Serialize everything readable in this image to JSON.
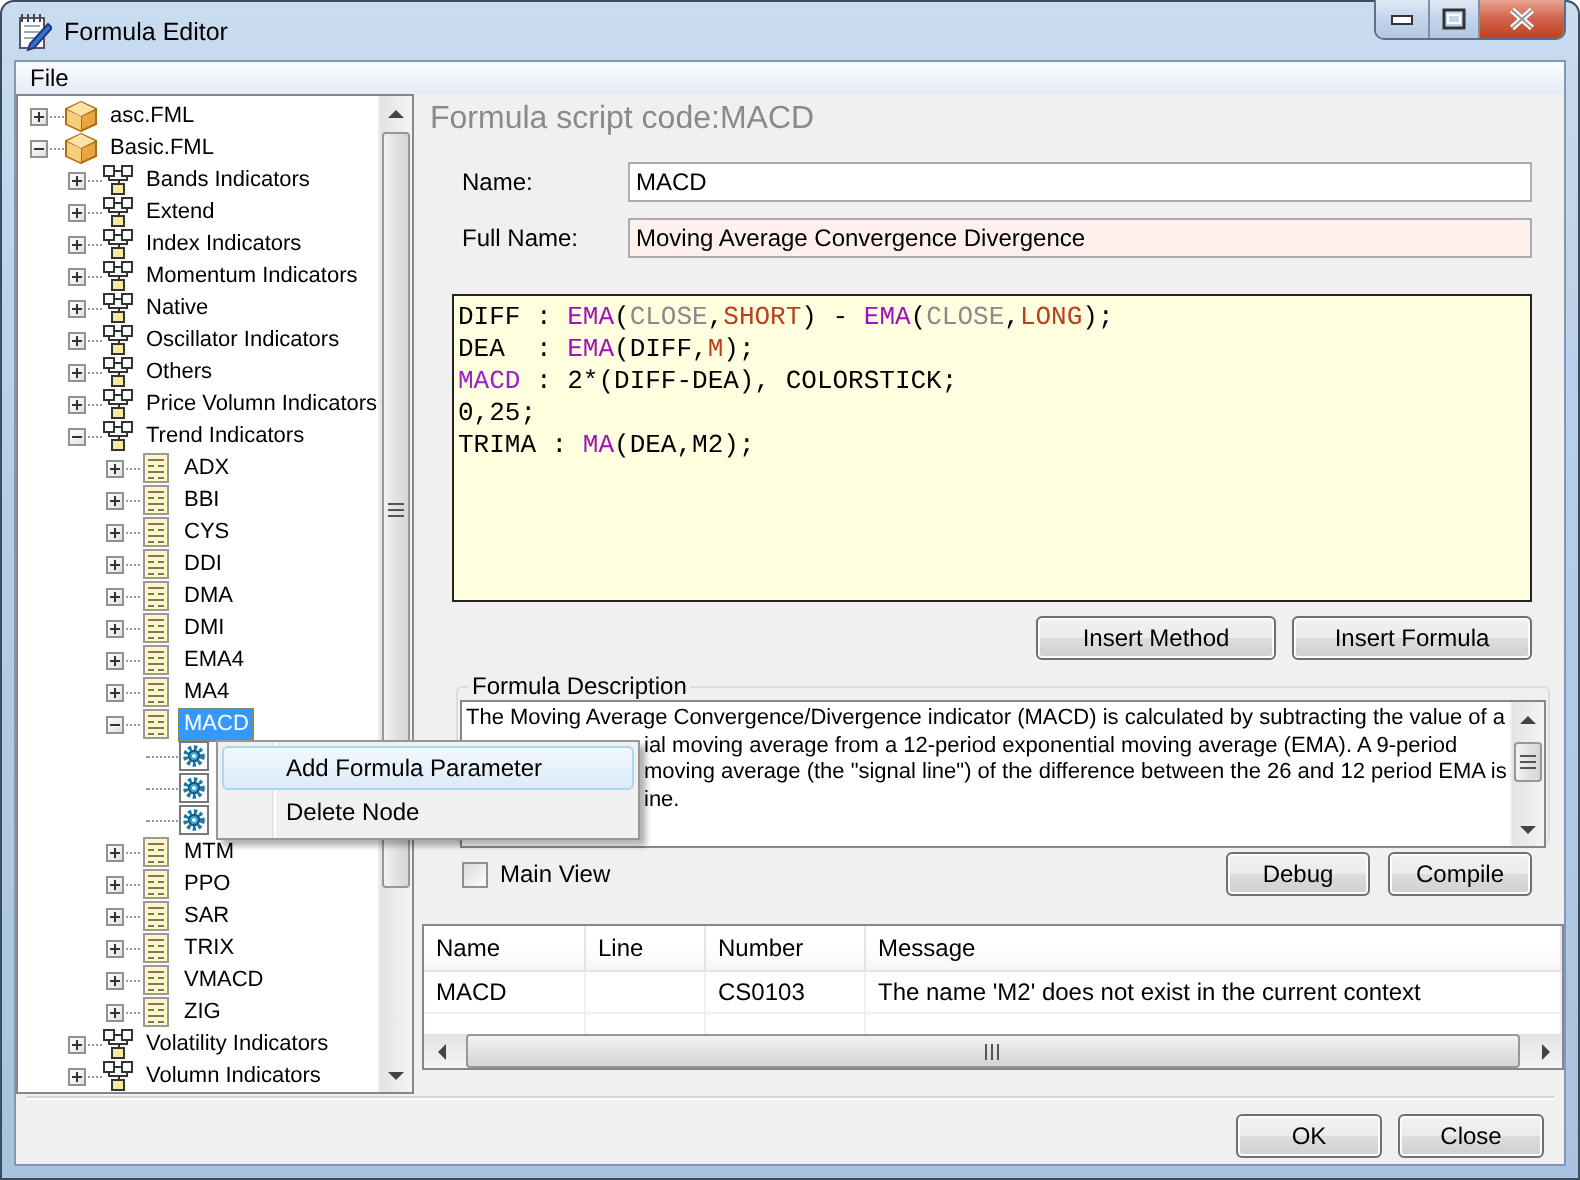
{
  "window": {
    "title": "Formula Editor"
  },
  "menu_bar": [
    "File"
  ],
  "tree": [
    {
      "kind": "file",
      "label": "asc.FML",
      "expanded": false,
      "selected": false
    },
    {
      "kind": "file",
      "label": "Basic.FML",
      "expanded": true,
      "selected": false,
      "children": [
        {
          "kind": "folder",
          "label": "Bands Indicators",
          "expanded": false,
          "selected": false
        },
        {
          "kind": "folder",
          "label": "Extend",
          "expanded": false,
          "selected": false
        },
        {
          "kind": "folder",
          "label": "Index Indicators",
          "expanded": false,
          "selected": false
        },
        {
          "kind": "folder",
          "label": "Momentum Indicators",
          "expanded": false,
          "selected": false
        },
        {
          "kind": "folder",
          "label": "Native",
          "expanded": false,
          "selected": false
        },
        {
          "kind": "folder",
          "label": "Oscillator Indicators",
          "expanded": false,
          "selected": false
        },
        {
          "kind": "folder",
          "label": "Others",
          "expanded": false,
          "selected": false
        },
        {
          "kind": "folder",
          "label": "Price Volumn Indicators",
          "expanded": false,
          "selected": false
        },
        {
          "kind": "folder",
          "label": "Trend Indicators",
          "expanded": true,
          "selected": false,
          "children": [
            {
              "kind": "formula",
              "label": "ADX",
              "expanded": false,
              "selected": false
            },
            {
              "kind": "formula",
              "label": "BBI",
              "expanded": false,
              "selected": false
            },
            {
              "kind": "formula",
              "label": "CYS",
              "expanded": false,
              "selected": false
            },
            {
              "kind": "formula",
              "label": "DDI",
              "expanded": false,
              "selected": false
            },
            {
              "kind": "formula",
              "label": "DMA",
              "expanded": false,
              "selected": false
            },
            {
              "kind": "formula",
              "label": "DMI",
              "expanded": false,
              "selected": false
            },
            {
              "kind": "formula",
              "label": "EMA4",
              "expanded": false,
              "selected": false
            },
            {
              "kind": "formula",
              "label": "MA4",
              "expanded": false,
              "selected": false
            },
            {
              "kind": "formula",
              "label": "MACD",
              "expanded": true,
              "selected": true,
              "children": [
                {
                  "kind": "param",
                  "selected": false
                },
                {
                  "kind": "param",
                  "selected": false
                },
                {
                  "kind": "param",
                  "selected": false
                }
              ]
            },
            {
              "kind": "formula",
              "label": "MTM",
              "expanded": false,
              "selected": false
            },
            {
              "kind": "formula",
              "label": "PPO",
              "expanded": false,
              "selected": false
            },
            {
              "kind": "formula",
              "label": "SAR",
              "expanded": false,
              "selected": false
            },
            {
              "kind": "formula",
              "label": "TRIX",
              "expanded": false,
              "selected": false
            },
            {
              "kind": "formula",
              "label": "VMACD",
              "expanded": false,
              "selected": false
            },
            {
              "kind": "formula",
              "label": "ZIG",
              "expanded": false,
              "selected": false
            }
          ]
        },
        {
          "kind": "folder",
          "label": "Volatility Indicators",
          "expanded": false,
          "selected": false
        },
        {
          "kind": "folder",
          "label": "Volumn Indicators",
          "expanded": false,
          "selected": false
        }
      ]
    }
  ],
  "formula_panel": {
    "header": "Formula script code:MACD",
    "fields": [
      {
        "label": "Name:",
        "value": "MACD",
        "highlighted": false
      },
      {
        "label": "Full Name:",
        "value": "Moving Average Convergence Divergence",
        "highlighted": true
      }
    ],
    "code_lines": [
      [
        {
          "kind": "plain",
          "text": "DIFF : "
        },
        {
          "kind": "function",
          "text": "EMA"
        },
        {
          "kind": "plain",
          "text": "("
        },
        {
          "kind": "builtin",
          "text": "CLOSE"
        },
        {
          "kind": "plain",
          "text": ","
        },
        {
          "kind": "param",
          "text": "SHORT"
        },
        {
          "kind": "plain",
          "text": ") - "
        },
        {
          "kind": "function",
          "text": "EMA"
        },
        {
          "kind": "plain",
          "text": "("
        },
        {
          "kind": "builtin",
          "text": "CLOSE"
        },
        {
          "kind": "plain",
          "text": ","
        },
        {
          "kind": "param",
          "text": "LONG"
        },
        {
          "kind": "plain",
          "text": ");"
        }
      ],
      [
        {
          "kind": "plain",
          "text": "DEA  : "
        },
        {
          "kind": "function",
          "text": "EMA"
        },
        {
          "kind": "plain",
          "text": "(DIFF,"
        },
        {
          "kind": "param",
          "text": "M"
        },
        {
          "kind": "plain",
          "text": ");"
        }
      ],
      [
        {
          "kind": "output",
          "text": "MACD"
        },
        {
          "kind": "plain",
          "text": " : 2*(DIFF-DEA), COLORSTICK;"
        }
      ],
      [
        {
          "kind": "plain",
          "text": "0,25;"
        }
      ],
      [
        {
          "kind": "plain",
          "text": "TRIMA : "
        },
        {
          "kind": "function",
          "text": "MA"
        },
        {
          "kind": "plain",
          "text": "(DEA,M2);"
        }
      ]
    ],
    "code_buttons": [
      "Insert Method",
      "Insert Formula"
    ],
    "description": {
      "title": "Formula Description",
      "lines": [
        {
          "text": "The Moving Average Convergence/Divergence indicator (MACD) is calculated by subtracting the value of a",
          "covered": false
        },
        {
          "text": "ial moving average from a 12-period exponential moving average (EMA). A 9-period",
          "covered": true
        },
        {
          "text": "moving average (the \"signal line\") of the difference between the 26 and 12 period EMA is",
          "covered": true
        },
        {
          "text": "ine.",
          "covered": true
        }
      ]
    },
    "main_view": {
      "label": "Main View",
      "checked": false
    },
    "action_buttons": [
      "Debug",
      "Compile"
    ]
  },
  "error_table": {
    "columns": [
      "Name",
      "Line",
      "Number",
      "Message"
    ],
    "rows": [
      [
        "MACD",
        null,
        "CS0103",
        "The name 'M2' does not exist in the current context"
      ]
    ]
  },
  "context_menu": [
    {
      "label": "Add Formula Parameter",
      "selected": true
    },
    {
      "label": "Delete Node",
      "selected": false
    }
  ],
  "footer_buttons": [
    "OK",
    "Close"
  ]
}
